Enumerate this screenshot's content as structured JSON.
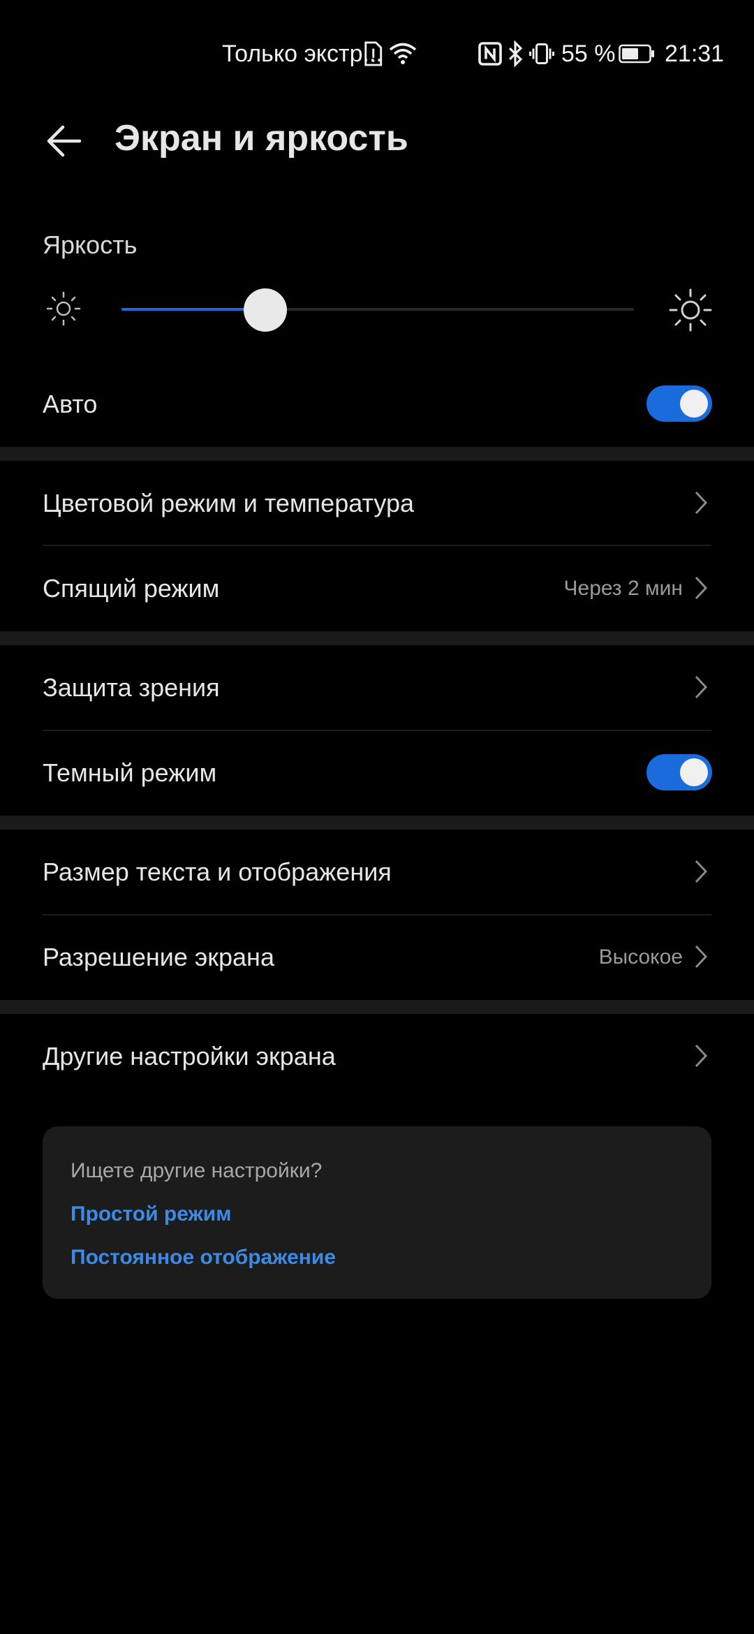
{
  "status_bar": {
    "carrier_text": "Только экстр...",
    "battery_percent": "55 %",
    "time": "21:31",
    "icons": [
      "sim-alert-icon",
      "wifi-icon",
      "nfc-icon",
      "bluetooth-icon",
      "vibrate-icon",
      "battery-icon"
    ]
  },
  "header": {
    "title": "Экран и яркость",
    "back_icon": "back-arrow-icon"
  },
  "brightness": {
    "label": "Яркость",
    "level": 0.28
  },
  "settings": {
    "auto": {
      "label": "Авто",
      "enabled": true
    },
    "color_mode": {
      "label": "Цветовой режим и температура"
    },
    "sleep": {
      "label": "Спящий режим",
      "value": "Через 2 мин"
    },
    "eye_comfort": {
      "label": "Защита зрения"
    },
    "dark_mode": {
      "label": "Темный режим",
      "enabled": true
    },
    "text_size": {
      "label": "Размер текста и отображения"
    },
    "resolution": {
      "label": "Разрешение экрана",
      "value": "Высокое"
    },
    "more": {
      "label": "Другие настройки экрана"
    }
  },
  "suggestions": {
    "question": "Ищете другие настройки?",
    "links": [
      "Простой режим",
      "Постоянное отображение"
    ]
  },
  "colors": {
    "background": "#000000",
    "accent": "#1a6bdc",
    "link": "#3b8ae6"
  }
}
